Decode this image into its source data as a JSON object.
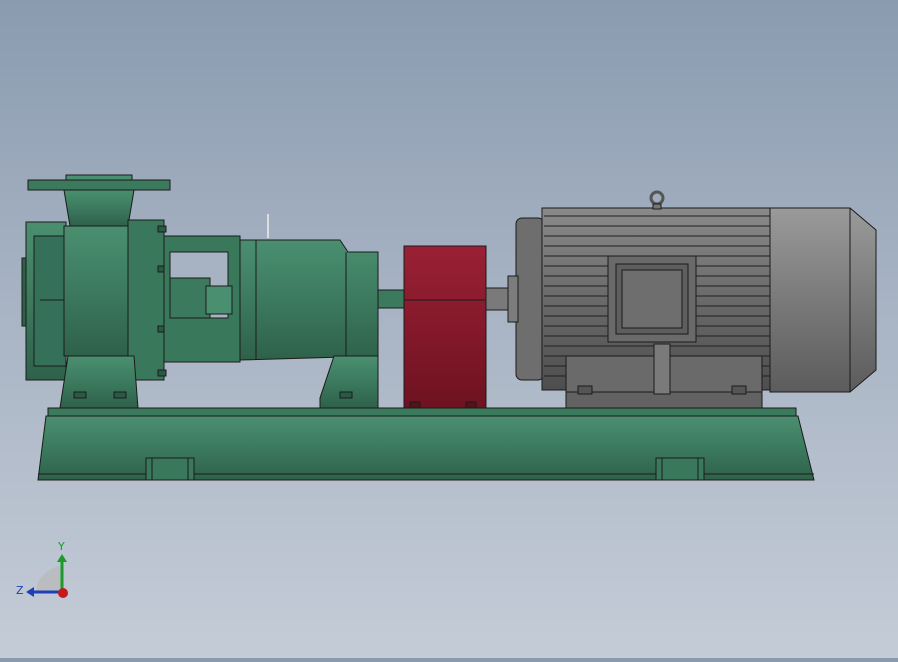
{
  "viewport": {
    "background_top": "#8a9bb0",
    "background_bottom": "#c4ccd7"
  },
  "model": {
    "pump_color": "#3c7a5e",
    "pump_dark": "#2a5a44",
    "coupling_guard_color": "#8c1b2e",
    "motor_color": "#6b6b6b",
    "motor_cap_color": "#7d7d7d",
    "outline_color": "#1b1b1b"
  },
  "triad": {
    "y_label": "Y",
    "z_label": "Z",
    "y_color": "#1a9b2a",
    "z_color": "#1f3fb5",
    "x_color": "#c41a1a"
  }
}
